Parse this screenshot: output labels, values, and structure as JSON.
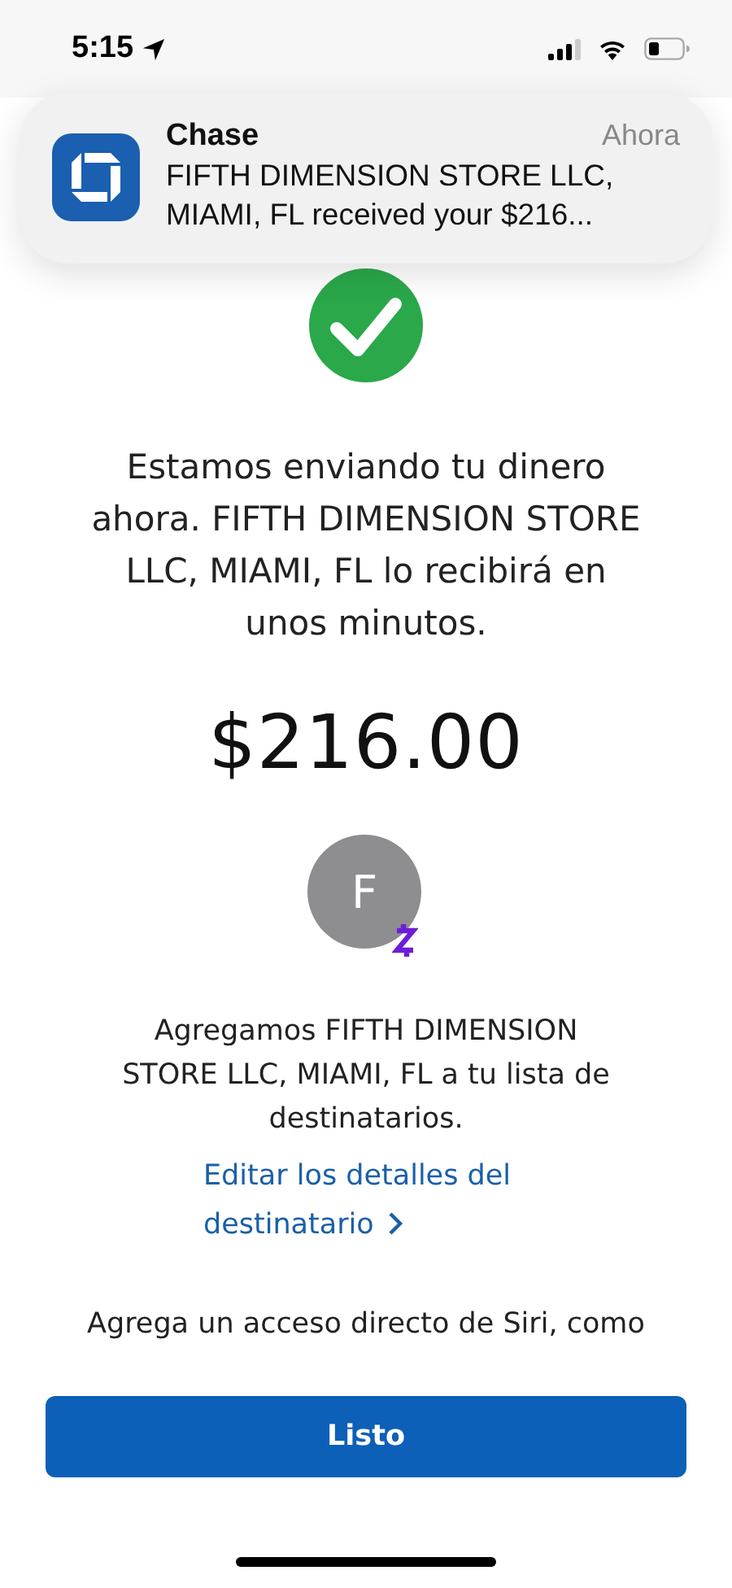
{
  "status_bar": {
    "time": "5:15"
  },
  "notification": {
    "app": "Chase",
    "time": "Ahora",
    "body": "FIFTH DIMENSION STORE LLC, MIAMI, FL received your $216..."
  },
  "message": "Estamos enviando tu dinero ahora. FIFTH DIMENSION STORE LLC, MIAMI, FL lo recibirá en unos minutos.",
  "amount": "$216.00",
  "recipient": {
    "initial": "F"
  },
  "added_text": "Agregamos FIFTH DIMENSION STORE LLC, MIAMI, FL a tu lista de destinatarios.",
  "edit_link": "Editar los detalles del destinatario",
  "siri_text": "Agrega un acceso directo de Siri, como",
  "done_button": "Listo"
}
